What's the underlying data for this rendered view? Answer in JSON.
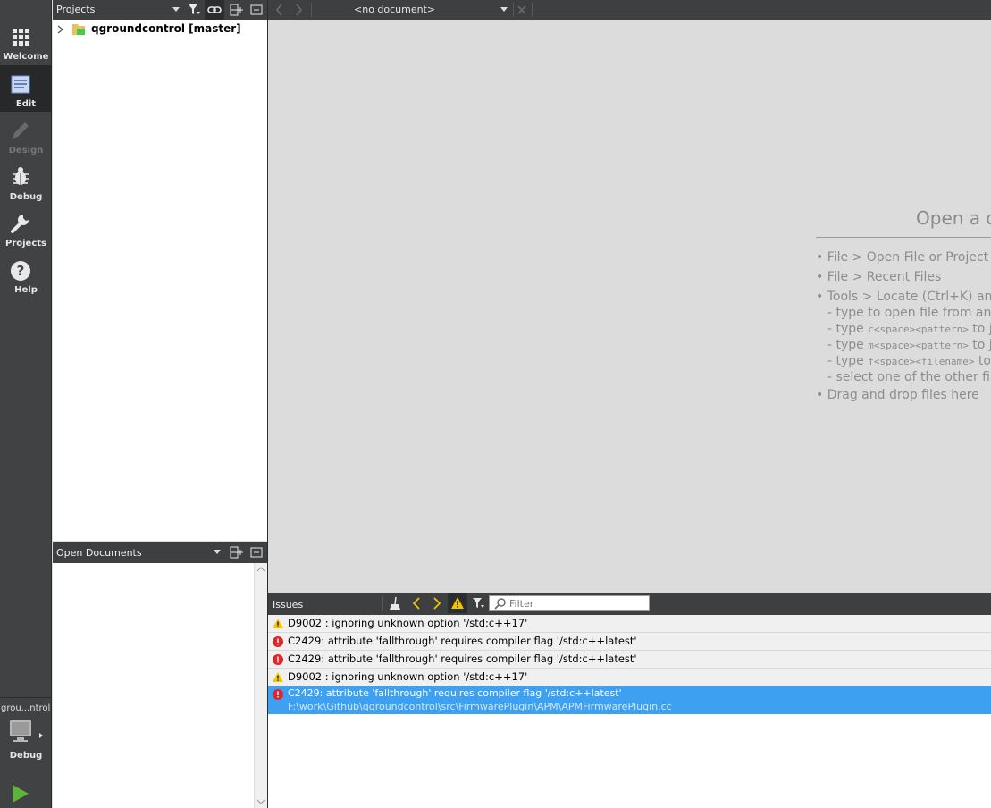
{
  "modes": [
    {
      "label": "Welcome",
      "icon": "welcome-grid-icon"
    },
    {
      "label": "Edit",
      "icon": "edit-document-icon",
      "active": true
    },
    {
      "label": "Design",
      "icon": "design-pencil-icon",
      "disabled": true
    },
    {
      "label": "Debug",
      "icon": "debug-bug-icon"
    },
    {
      "label": "Projects",
      "icon": "projects-wrench-icon"
    },
    {
      "label": "Help",
      "icon": "help-question-icon"
    }
  ],
  "kit": {
    "name": "grou...ntrol",
    "build_mode": "Debug"
  },
  "projects_pane": {
    "title": "Projects",
    "tree": [
      {
        "label": "qgroundcontrol [master]",
        "icon": "qt-project-folder-icon"
      }
    ]
  },
  "open_documents_pane": {
    "title": "Open Documents"
  },
  "editor": {
    "document_combo": "<no document>",
    "welcome": {
      "title": "Open a document",
      "hints": [
        {
          "text": "• File > Open File or Project (Ctrl+O)"
        },
        {
          "text": "• File > Recent Files"
        },
        {
          "text": "• Tools > Locate (Ctrl+K) and"
        },
        {
          "text": "- type to open file from any open project"
        },
        {
          "prefix": "- type ",
          "code": "c<space><pattern>",
          "suffix": " to jump to a class definition"
        },
        {
          "prefix": "- type ",
          "code": "m<space><pattern>",
          "suffix": " to jump to a function definition"
        },
        {
          "prefix": "- type ",
          "code": "f<space><filename>",
          "suffix": " to open file from file system"
        },
        {
          "text": "- select one of the other filters for jumping to a location"
        },
        {
          "text": "• Drag and drop files here"
        }
      ]
    }
  },
  "issues": {
    "title": "Issues",
    "filter_placeholder": "Filter",
    "rows": [
      {
        "severity": "warning",
        "message": "D9002 : ignoring unknown option '/std:c++17'"
      },
      {
        "severity": "error",
        "message": "C2429: attribute 'fallthrough' requires compiler flag '/std:c++latest'"
      },
      {
        "severity": "error",
        "message": "C2429: attribute 'fallthrough' requires compiler flag '/std:c++latest'"
      },
      {
        "severity": "warning",
        "message": "D9002 : ignoring unknown option '/std:c++17'"
      },
      {
        "severity": "error",
        "message": "C2429: attribute 'fallthrough' requires compiler flag '/std:c++latest'",
        "file": "F:\\work\\Github\\qgroundcontrol\\src\\FirmwarePlugin\\APM\\APMFirmwarePlugin.cc",
        "selected": true
      }
    ]
  },
  "colors": {
    "sidebar": "#404244",
    "sidebar_active": "#262829",
    "toolbar": "#3d3f41",
    "selection": "#3ea0f0",
    "warning": "#f5c400",
    "error": "#e0262a",
    "run": "#5fb33b"
  }
}
